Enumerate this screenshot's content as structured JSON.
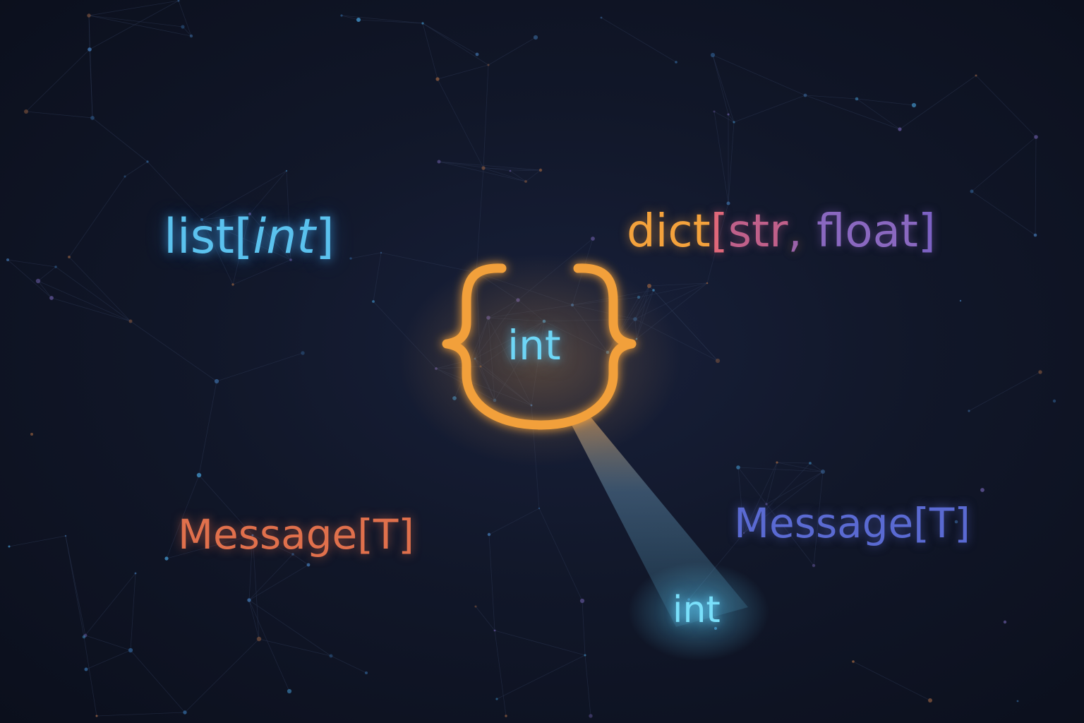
{
  "labels": {
    "list_prefix": "list[",
    "list_inner": "int",
    "list_suffix": "]",
    "dict_name": "dict",
    "dict_open": "[",
    "dict_key": "str",
    "dict_comma": ",",
    "dict_value": "float",
    "dict_close": "]",
    "message_left": "Message[T]",
    "message_right": "Message[T]",
    "center_type": "int",
    "projected_type": "int"
  },
  "colors": {
    "background": "#0d1120",
    "list": "#5bc2ee",
    "dict": "#f4a23c",
    "brace": "#f2a03a",
    "message_left": "#e0704c",
    "message_right": "#5a6ad2",
    "int": "#6ed6f6"
  },
  "icons": {
    "center": "curly-brace-icon",
    "beam": "light-beam-icon"
  }
}
